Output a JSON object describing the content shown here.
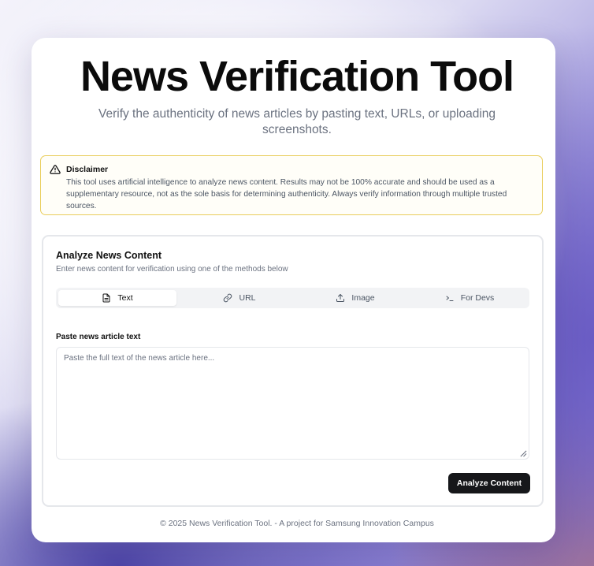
{
  "header": {
    "title": "News Verification Tool",
    "subtitle": "Verify the authenticity of news articles by pasting text, URLs, or uploading screenshots."
  },
  "disclaimer": {
    "icon": "alert-triangle-icon",
    "title": "Disclaimer",
    "body": "This tool uses artificial intelligence to analyze news content. Results may not be 100% accurate and should be used as a supplementary resource, not as the sole basis for determining authenticity. Always verify information through multiple trusted sources.",
    "border_color": "#e9cd5a"
  },
  "panel": {
    "title": "Analyze News Content",
    "subtitle": "Enter news content for verification using one of the methods below",
    "tabs": [
      {
        "label": "Text",
        "icon": "file-text-icon",
        "active": true
      },
      {
        "label": "URL",
        "icon": "link-icon",
        "active": false
      },
      {
        "label": "Image",
        "icon": "upload-icon",
        "active": false
      },
      {
        "label": "For Devs",
        "icon": "terminal-icon",
        "active": false
      }
    ],
    "field_label": "Paste news article text",
    "textarea_placeholder": "Paste the full text of the news article here...",
    "textarea_value": "",
    "button_label": "Analyze Content"
  },
  "footer": {
    "text": "© 2025 News Verification Tool. - A project for Samsung Innovation Campus"
  },
  "colors": {
    "button_bg": "#16171a",
    "title": "#0b0b0b",
    "muted_text": "#6b7280"
  }
}
